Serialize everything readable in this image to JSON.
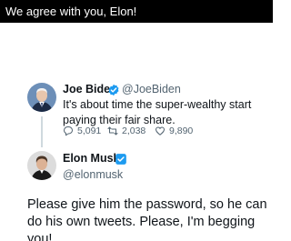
{
  "caption": {
    "text": "We agree with you, Elon!"
  },
  "quoted_tweet": {
    "author_name": "Joe Biden",
    "author_handle": "@JoeBiden",
    "verified": true,
    "text": "It's about time the super-wealthy start paying their fair share.",
    "stats": {
      "replies": "5,091",
      "retweets": "2,038",
      "likes": "9,890"
    }
  },
  "reply_tweet": {
    "author_name": "Elon Musk",
    "author_handle": "@elonmusk",
    "verified": true,
    "text": "Please give him the password, so he can do his own tweets. Please, I'm begging you!"
  },
  "colors": {
    "caption_bg": "#000000",
    "verified_blue": "#1d9bf0",
    "secondary_text": "#536471",
    "thread_line": "#cfd9de"
  },
  "icons": [
    "verified-badge-icon",
    "reply-icon",
    "retweet-icon",
    "like-icon"
  ]
}
